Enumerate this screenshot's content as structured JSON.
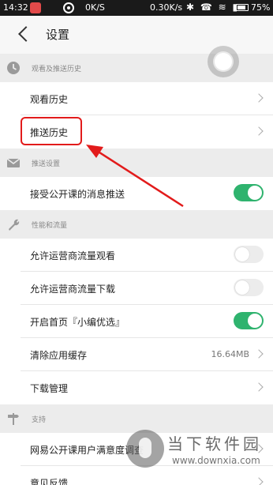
{
  "status_bar": {
    "time": "14:32",
    "net_left": "0K/S",
    "net_right": "0.30K/s",
    "icons": "✱ ☎ ≋ ▮",
    "battery": "75%"
  },
  "header": {
    "title": "设置"
  },
  "sections": [
    {
      "title": "观看及推送历史",
      "icon": "clock-icon"
    },
    {
      "title": "推送设置",
      "icon": "mail-icon"
    },
    {
      "title": "性能和流量",
      "icon": "wrench-icon"
    },
    {
      "title": "支持",
      "icon": "signpost-icon"
    }
  ],
  "rows": {
    "watch_history": "观看历史",
    "push_history": "推送历史",
    "accept_push": "接受公开课的消息推送",
    "carrier_watch": "允许运营商流量观看",
    "carrier_download": "允许运营商流量下载",
    "home_picks": "开启首页『小编优选』",
    "clear_cache": "清除应用缓存",
    "cache_size": "16.64MB",
    "download_mgmt": "下载管理",
    "survey": "网易公开课用户满意度调查",
    "feedback": "意见反馈"
  },
  "toggles": {
    "accept_push": true,
    "carrier_watch": false,
    "carrier_download": false,
    "home_picks": true
  },
  "colors": {
    "toggle_on": "#2fb36e",
    "annotation": "#e21b1b"
  },
  "watermark": {
    "title": "当下软件园",
    "url": "www.downxia.com"
  }
}
